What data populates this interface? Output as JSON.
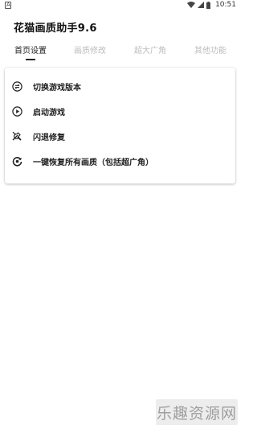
{
  "status_bar": {
    "time": "10:51",
    "icons": [
      "notification-a-icon",
      "wifi-icon",
      "signal-icon",
      "battery-icon"
    ]
  },
  "app": {
    "title": "花猫画质助手9.6"
  },
  "tabs": [
    {
      "label": "首页设置",
      "active": true
    },
    {
      "label": "画质修改",
      "active": false
    },
    {
      "label": "超大广角",
      "active": false
    },
    {
      "label": "其他功能",
      "active": false
    }
  ],
  "menu": {
    "items": [
      {
        "label": "切换游戏版本",
        "icon": "switch-arrows-icon"
      },
      {
        "label": "启动游戏",
        "icon": "play-circle-icon"
      },
      {
        "label": "闪退修复",
        "icon": "tools-icon"
      },
      {
        "label": "一键恢复所有画质（包括超广角）",
        "icon": "restore-icon"
      }
    ]
  },
  "watermark": {
    "text": "乐趣资源网"
  },
  "colors": {
    "active_tab": "#222222",
    "inactive_tab": "#bdbdbd",
    "background": "#ffffff"
  }
}
